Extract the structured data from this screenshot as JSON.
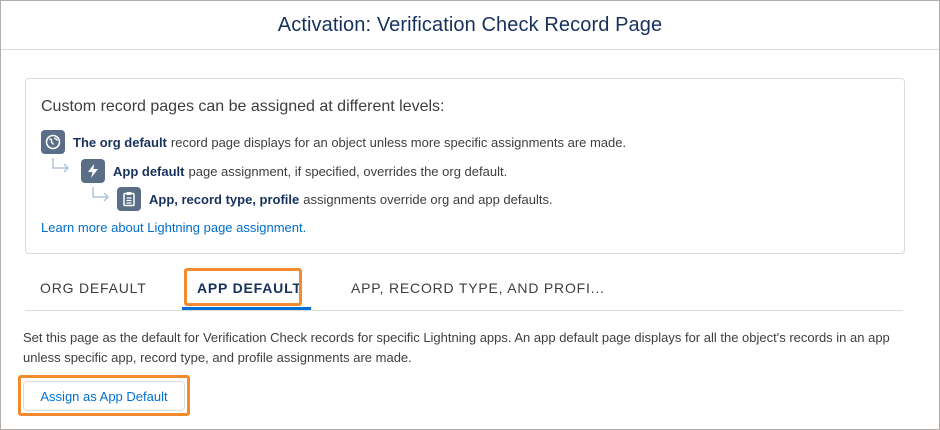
{
  "header": {
    "title": "Activation: Verification Check Record Page"
  },
  "info": {
    "heading": "Custom record pages can be assigned at different levels:",
    "levels": [
      {
        "icon": "globe-icon",
        "bold": "The org default",
        "text": "record page displays for an object unless more specific assignments are made."
      },
      {
        "icon": "lightning-bolt-icon",
        "bold": "App default",
        "text": "page assignment, if specified, overrides the org default."
      },
      {
        "icon": "clipboard-icon",
        "bold": "App, record type, profile",
        "text": "assignments override org and app defaults."
      }
    ],
    "learn_more": "Learn more about Lightning page assignment."
  },
  "tabs": [
    {
      "label": "ORG DEFAULT",
      "active": false
    },
    {
      "label": "APP DEFAULT",
      "active": true
    },
    {
      "label": "APP, RECORD TYPE, AND PROFI...",
      "active": false
    }
  ],
  "description": "Set this page as the default for Verification Check records for specific Lightning apps. An app default page displays for all the object's records in an app unless specific app, record type, and profile assignments are made.",
  "assign_button": "Assign as App Default",
  "colors": {
    "highlight": "#f38a2e",
    "link": "#006dcc",
    "active_tab_underline": "#0070d2",
    "icon_bg": "#5a6e87"
  }
}
